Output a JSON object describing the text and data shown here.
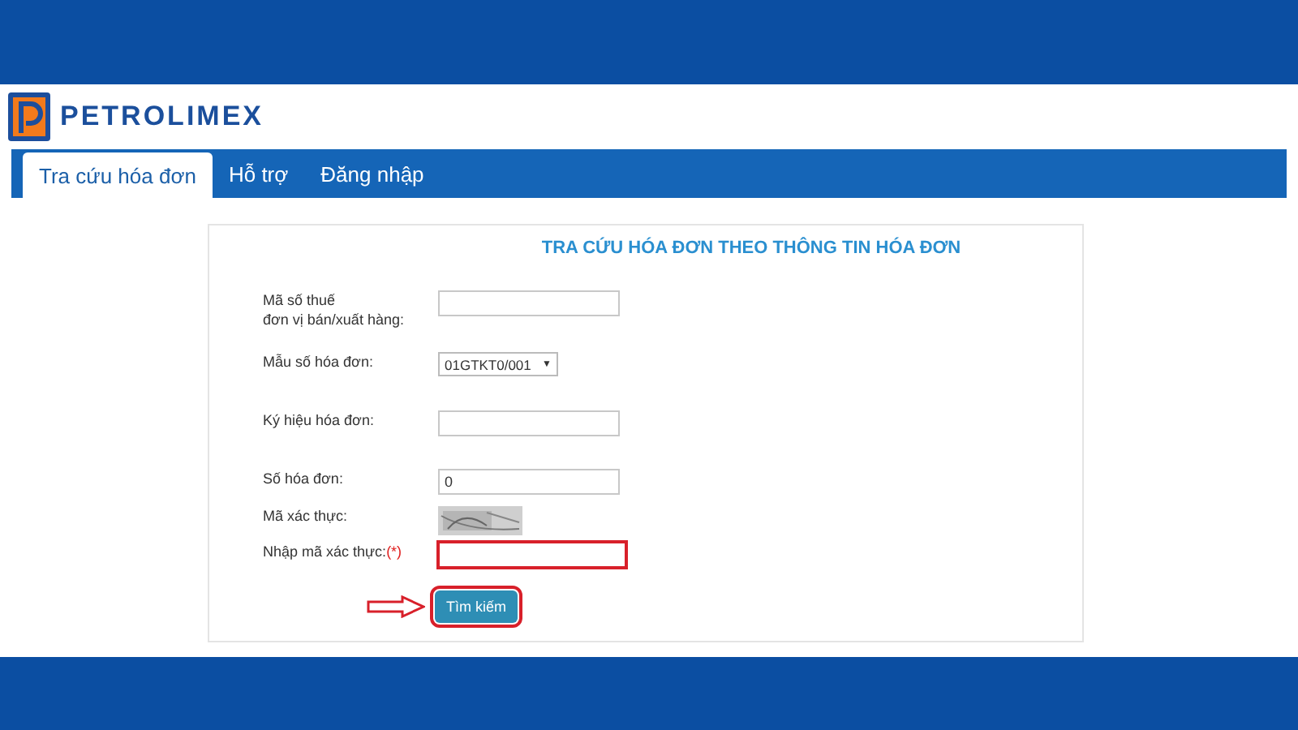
{
  "header": {
    "logo_text": "PETROLIMEX"
  },
  "tabs": [
    {
      "label": "Tra cứu hóa đơn",
      "selected": true
    },
    {
      "label": "Hỗ trợ",
      "selected": false
    },
    {
      "label": "Đăng nhập",
      "selected": false
    }
  ],
  "form": {
    "title": "TRA CỨU HÓA ĐƠN THEO THÔNG TIN HÓA ĐƠN",
    "rows": [
      {
        "kind": "input",
        "label_lines": [
          "Mã số thuế",
          "đơn vị bán/xuất hàng:"
        ],
        "value": ""
      },
      {
        "kind": "select",
        "label_lines": [
          "Mẫu số hóa đơn:"
        ],
        "value": "01GTKT0/001",
        "caret": "▼"
      },
      {
        "kind": "input",
        "label_lines": [
          "Ký hiệu hóa đơn:"
        ],
        "value": ""
      },
      {
        "kind": "input",
        "label_lines": [
          "Số hóa đơn:"
        ],
        "value": "0"
      },
      {
        "kind": "captcha",
        "label_lines": [
          "Mã xác thực:"
        ]
      },
      {
        "kind": "input",
        "label_lines": [
          "Nhập mã xác thực:"
        ],
        "required_mark": "(*)",
        "value": "",
        "highlighted": true
      }
    ],
    "submit": {
      "label": "Tìm kiếm",
      "highlighted": true,
      "pointer_arrow": true
    }
  }
}
